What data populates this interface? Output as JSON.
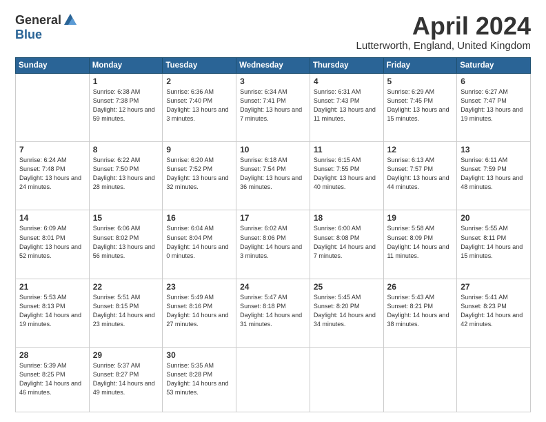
{
  "header": {
    "logo_general": "General",
    "logo_blue": "Blue",
    "month_title": "April 2024",
    "location": "Lutterworth, England, United Kingdom"
  },
  "days_of_week": [
    "Sunday",
    "Monday",
    "Tuesday",
    "Wednesday",
    "Thursday",
    "Friday",
    "Saturday"
  ],
  "weeks": [
    [
      {
        "day": "",
        "content": ""
      },
      {
        "day": "1",
        "content": "Sunrise: 6:38 AM\nSunset: 7:38 PM\nDaylight: 12 hours\nand 59 minutes."
      },
      {
        "day": "2",
        "content": "Sunrise: 6:36 AM\nSunset: 7:40 PM\nDaylight: 13 hours\nand 3 minutes."
      },
      {
        "day": "3",
        "content": "Sunrise: 6:34 AM\nSunset: 7:41 PM\nDaylight: 13 hours\nand 7 minutes."
      },
      {
        "day": "4",
        "content": "Sunrise: 6:31 AM\nSunset: 7:43 PM\nDaylight: 13 hours\nand 11 minutes."
      },
      {
        "day": "5",
        "content": "Sunrise: 6:29 AM\nSunset: 7:45 PM\nDaylight: 13 hours\nand 15 minutes."
      },
      {
        "day": "6",
        "content": "Sunrise: 6:27 AM\nSunset: 7:47 PM\nDaylight: 13 hours\nand 19 minutes."
      }
    ],
    [
      {
        "day": "7",
        "content": "Sunrise: 6:24 AM\nSunset: 7:48 PM\nDaylight: 13 hours\nand 24 minutes."
      },
      {
        "day": "8",
        "content": "Sunrise: 6:22 AM\nSunset: 7:50 PM\nDaylight: 13 hours\nand 28 minutes."
      },
      {
        "day": "9",
        "content": "Sunrise: 6:20 AM\nSunset: 7:52 PM\nDaylight: 13 hours\nand 32 minutes."
      },
      {
        "day": "10",
        "content": "Sunrise: 6:18 AM\nSunset: 7:54 PM\nDaylight: 13 hours\nand 36 minutes."
      },
      {
        "day": "11",
        "content": "Sunrise: 6:15 AM\nSunset: 7:55 PM\nDaylight: 13 hours\nand 40 minutes."
      },
      {
        "day": "12",
        "content": "Sunrise: 6:13 AM\nSunset: 7:57 PM\nDaylight: 13 hours\nand 44 minutes."
      },
      {
        "day": "13",
        "content": "Sunrise: 6:11 AM\nSunset: 7:59 PM\nDaylight: 13 hours\nand 48 minutes."
      }
    ],
    [
      {
        "day": "14",
        "content": "Sunrise: 6:09 AM\nSunset: 8:01 PM\nDaylight: 13 hours\nand 52 minutes."
      },
      {
        "day": "15",
        "content": "Sunrise: 6:06 AM\nSunset: 8:02 PM\nDaylight: 13 hours\nand 56 minutes."
      },
      {
        "day": "16",
        "content": "Sunrise: 6:04 AM\nSunset: 8:04 PM\nDaylight: 14 hours\nand 0 minutes."
      },
      {
        "day": "17",
        "content": "Sunrise: 6:02 AM\nSunset: 8:06 PM\nDaylight: 14 hours\nand 3 minutes."
      },
      {
        "day": "18",
        "content": "Sunrise: 6:00 AM\nSunset: 8:08 PM\nDaylight: 14 hours\nand 7 minutes."
      },
      {
        "day": "19",
        "content": "Sunrise: 5:58 AM\nSunset: 8:09 PM\nDaylight: 14 hours\nand 11 minutes."
      },
      {
        "day": "20",
        "content": "Sunrise: 5:55 AM\nSunset: 8:11 PM\nDaylight: 14 hours\nand 15 minutes."
      }
    ],
    [
      {
        "day": "21",
        "content": "Sunrise: 5:53 AM\nSunset: 8:13 PM\nDaylight: 14 hours\nand 19 minutes."
      },
      {
        "day": "22",
        "content": "Sunrise: 5:51 AM\nSunset: 8:15 PM\nDaylight: 14 hours\nand 23 minutes."
      },
      {
        "day": "23",
        "content": "Sunrise: 5:49 AM\nSunset: 8:16 PM\nDaylight: 14 hours\nand 27 minutes."
      },
      {
        "day": "24",
        "content": "Sunrise: 5:47 AM\nSunset: 8:18 PM\nDaylight: 14 hours\nand 31 minutes."
      },
      {
        "day": "25",
        "content": "Sunrise: 5:45 AM\nSunset: 8:20 PM\nDaylight: 14 hours\nand 34 minutes."
      },
      {
        "day": "26",
        "content": "Sunrise: 5:43 AM\nSunset: 8:21 PM\nDaylight: 14 hours\nand 38 minutes."
      },
      {
        "day": "27",
        "content": "Sunrise: 5:41 AM\nSunset: 8:23 PM\nDaylight: 14 hours\nand 42 minutes."
      }
    ],
    [
      {
        "day": "28",
        "content": "Sunrise: 5:39 AM\nSunset: 8:25 PM\nDaylight: 14 hours\nand 46 minutes."
      },
      {
        "day": "29",
        "content": "Sunrise: 5:37 AM\nSunset: 8:27 PM\nDaylight: 14 hours\nand 49 minutes."
      },
      {
        "day": "30",
        "content": "Sunrise: 5:35 AM\nSunset: 8:28 PM\nDaylight: 14 hours\nand 53 minutes."
      },
      {
        "day": "",
        "content": ""
      },
      {
        "day": "",
        "content": ""
      },
      {
        "day": "",
        "content": ""
      },
      {
        "day": "",
        "content": ""
      }
    ]
  ]
}
